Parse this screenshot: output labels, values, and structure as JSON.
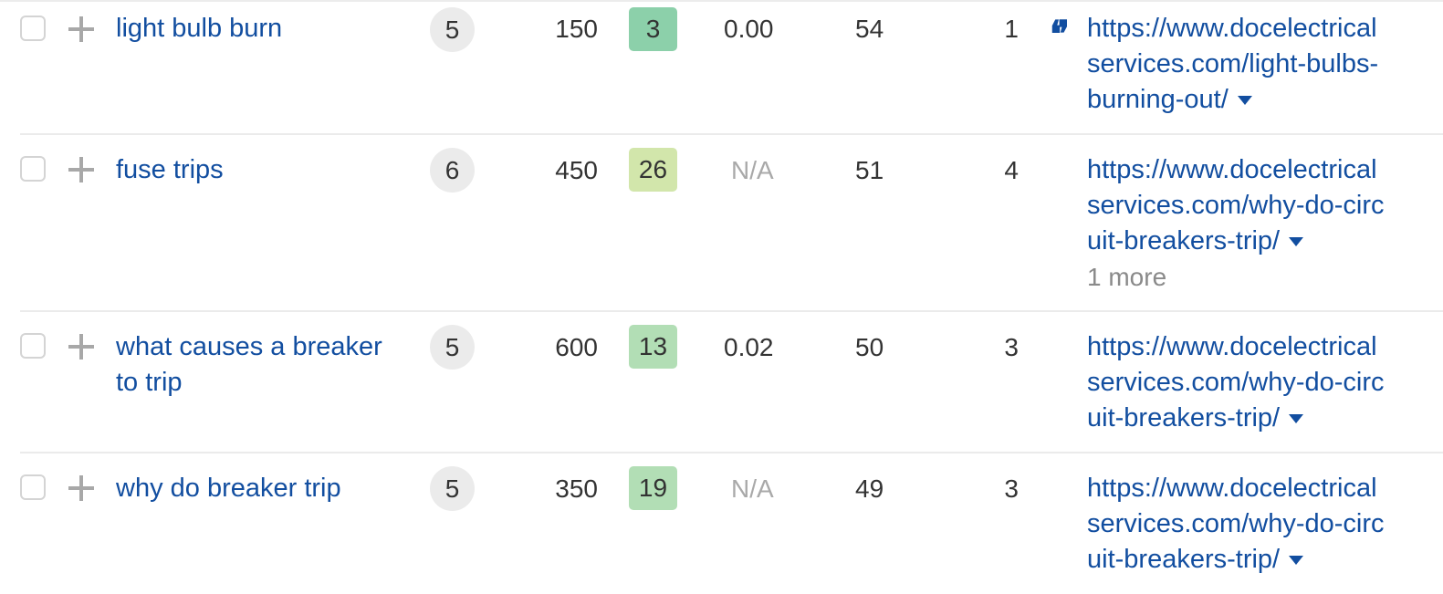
{
  "colors": {
    "link": "#124ea0",
    "kd_dark_green": "#8cd0aa",
    "kd_light_green": "#b2deb5",
    "kd_yellow_green": "#d2e6ab",
    "sf_bubble": "#ebebeb",
    "na_text": "#a9a9a9",
    "more_text": "#8a8a8a"
  },
  "rows": [
    {
      "keyword": "light bulb burn",
      "serp_features": "5",
      "volume": "150",
      "kd": "3",
      "kd_color": "#8cd0aa",
      "cpc": "0.00",
      "cpc_na": false,
      "traffic": "54",
      "position": "1",
      "has_quote_icon": true,
      "url_lines": [
        "https://www.docelectrical",
        "services.com/light-bulbs-",
        "burning-out/"
      ],
      "more": ""
    },
    {
      "keyword": "fuse trips",
      "serp_features": "6",
      "volume": "450",
      "kd": "26",
      "kd_color": "#d2e6ab",
      "cpc": "N/A",
      "cpc_na": true,
      "traffic": "51",
      "position": "4",
      "has_quote_icon": false,
      "url_lines": [
        "https://www.docelectrical",
        "services.com/why-do-circ",
        "uit-breakers-trip/"
      ],
      "more": "1 more"
    },
    {
      "keyword": "what causes a breaker to trip",
      "serp_features": "5",
      "volume": "600",
      "kd": "13",
      "kd_color": "#b2deb5",
      "cpc": "0.02",
      "cpc_na": false,
      "traffic": "50",
      "position": "3",
      "has_quote_icon": false,
      "url_lines": [
        "https://www.docelectrical",
        "services.com/why-do-circ",
        "uit-breakers-trip/"
      ],
      "more": ""
    },
    {
      "keyword": "why do breaker trip",
      "serp_features": "5",
      "volume": "350",
      "kd": "19",
      "kd_color": "#b2deb5",
      "cpc": "N/A",
      "cpc_na": true,
      "traffic": "49",
      "position": "3",
      "has_quote_icon": false,
      "url_lines": [
        "https://www.docelectrical",
        "services.com/why-do-circ",
        "uit-breakers-trip/"
      ],
      "more": ""
    }
  ]
}
